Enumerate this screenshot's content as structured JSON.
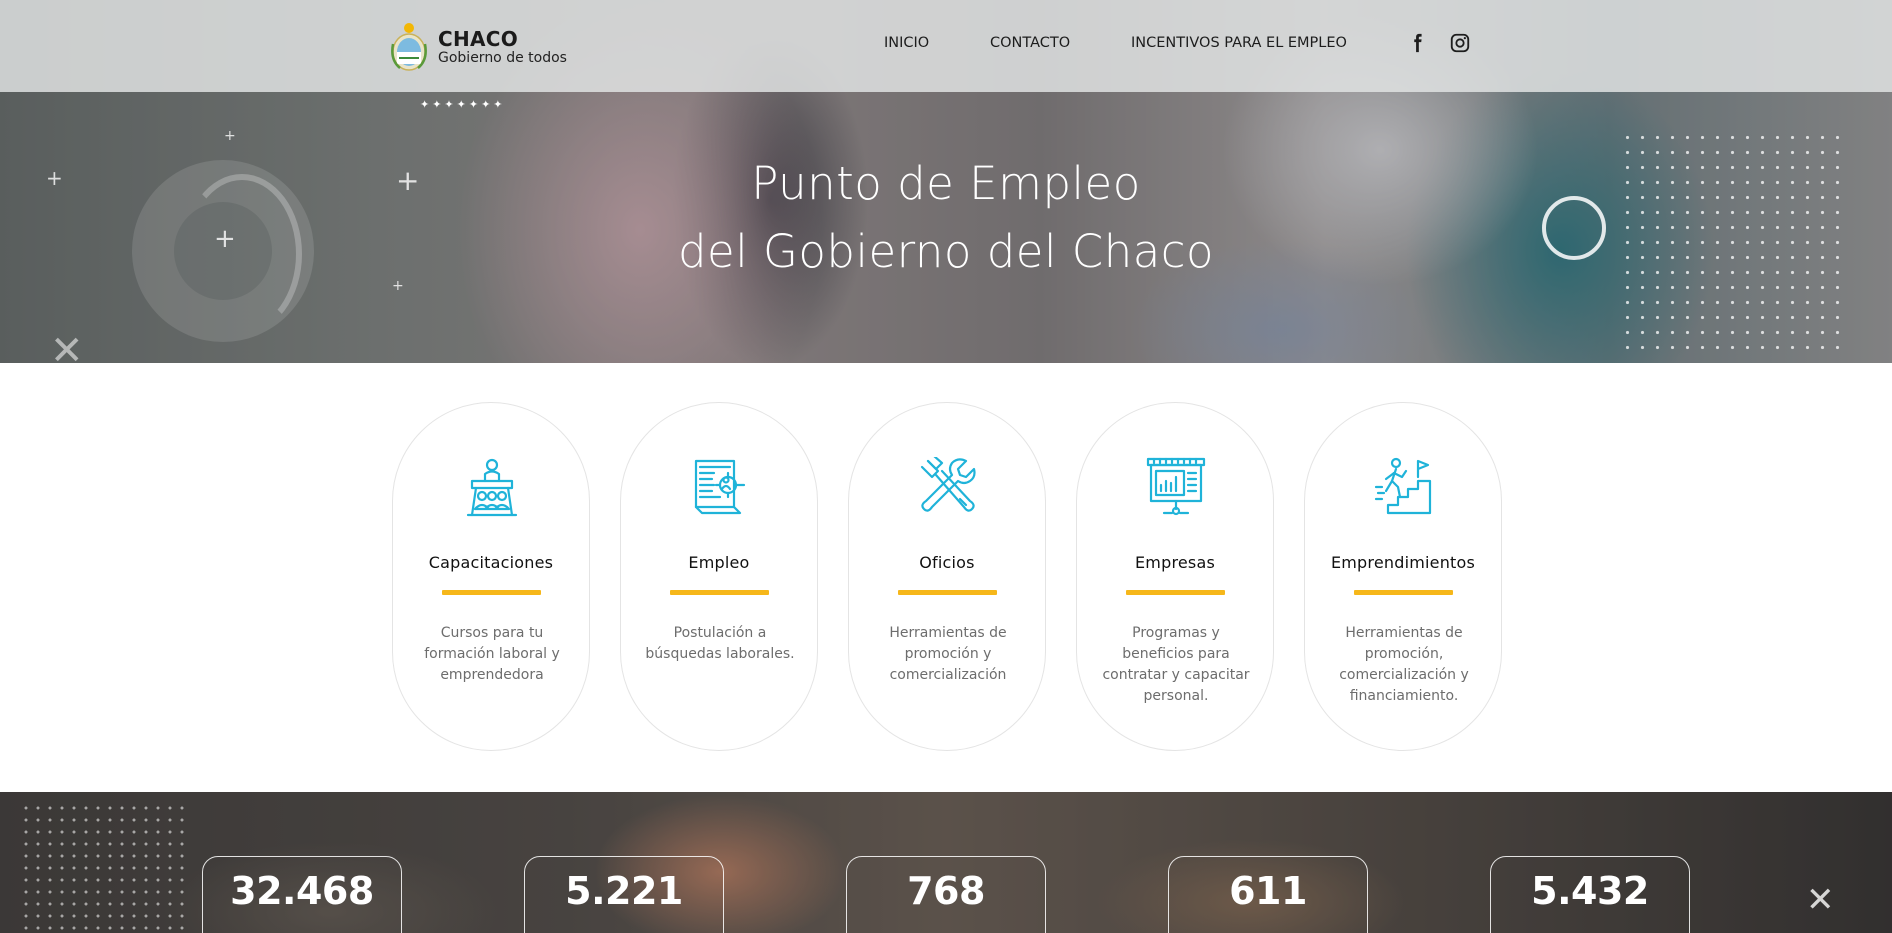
{
  "brand": {
    "title": "CHACO",
    "subtitle": "Gobierno de todos"
  },
  "nav": {
    "items": [
      "INICIO",
      "CONTACTO",
      "INCENTIVOS PARA EL EMPLEO"
    ],
    "social": [
      "facebook-icon",
      "instagram-icon"
    ]
  },
  "hero": {
    "line1": "Punto de Empleo",
    "line2": "del Gobierno del Chaco"
  },
  "cards": [
    {
      "icon": "training-icon",
      "title": "Capacitaciones",
      "description": "Cursos para tu formación laboral y emprendedora"
    },
    {
      "icon": "job-application-icon",
      "title": "Empleo",
      "description": "Postulación a búsquedas laborales."
    },
    {
      "icon": "tools-icon",
      "title": "Oficios",
      "description": "Herramientas de promoción y comercialización"
    },
    {
      "icon": "presentation-board-icon",
      "title": "Empresas",
      "description": "Programas y beneficios para contratar y capacitar personal."
    },
    {
      "icon": "climbing-stairs-icon",
      "title": "Emprendimientos",
      "description": "Herramientas de promoción, comercialización y financiamiento."
    }
  ],
  "stats": [
    "32.468",
    "5.221",
    "768",
    "611",
    "5.432"
  ],
  "colors": {
    "accent_bar": "#f6b71a",
    "icon": "#1fb3d9"
  }
}
